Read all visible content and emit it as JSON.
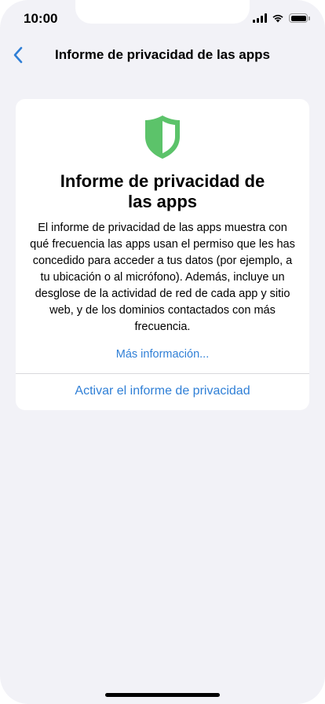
{
  "status_bar": {
    "time": "10:00",
    "icons": [
      "cellular-signal-icon",
      "wifi-icon",
      "battery-icon"
    ]
  },
  "nav": {
    "back_icon": "chevron-left-icon",
    "title": "Informe de privacidad de las apps"
  },
  "card": {
    "icon": "shield-icon",
    "title": "Informe de privacidad de las apps",
    "body": "El informe de privacidad de las apps muestra con qué frecuencia las apps usan el permiso que les has concedido para acceder a tus datos (por ejemplo, a tu ubicación o al micrófono). Además, incluye un desglose de la actividad de red de cada app y sitio web, y de los dominios contactados con más frecuencia.",
    "more_link": "Más información...",
    "activate_button": "Activar el informe de privacidad"
  },
  "colors": {
    "accent": "#2f7fd6",
    "shield_green": "#5cc36a",
    "background": "#f2f2f7"
  }
}
